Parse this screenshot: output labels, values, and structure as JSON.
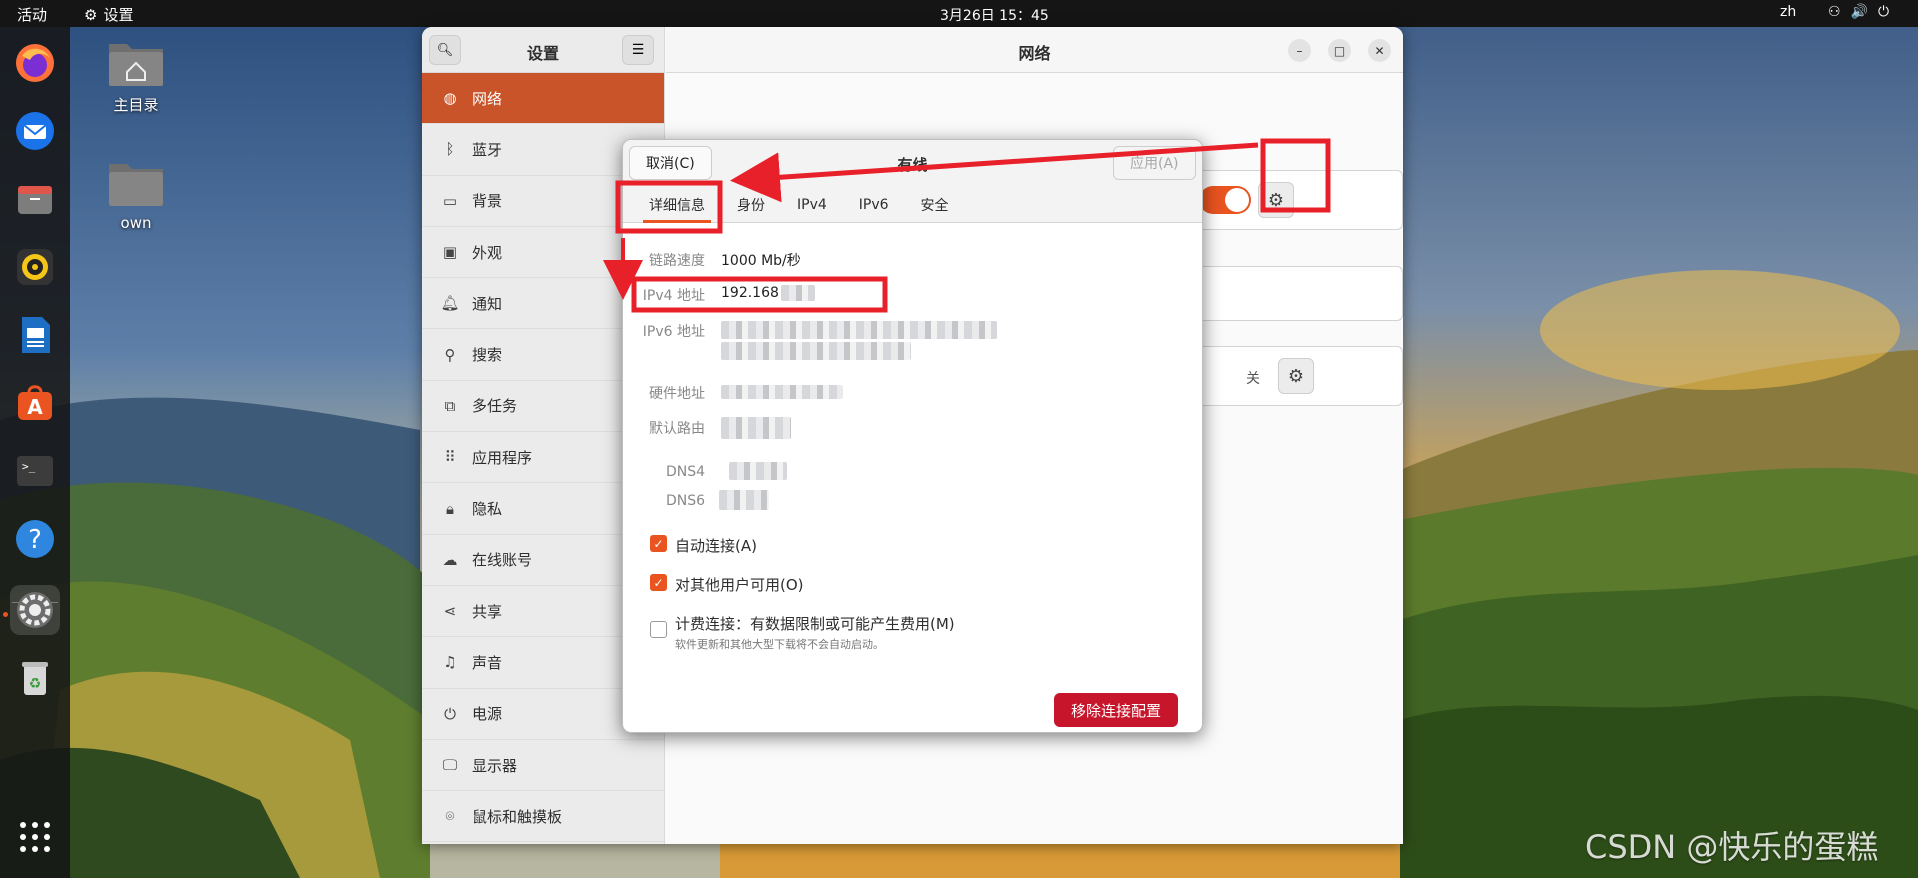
{
  "topbar": {
    "activities": "活动",
    "app_name": "设置",
    "clock": "3月26日  15：45",
    "lang": "zh"
  },
  "dock": {
    "items": [
      "firefox-icon",
      "thunderbird-icon",
      "files-icon",
      "rhythmbox-icon",
      "writer-icon",
      "app-center-icon",
      "terminal-icon",
      "help-icon",
      "settings-icon",
      "trash-icon",
      "app-grid-icon"
    ]
  },
  "desktop": {
    "icons": [
      {
        "label": "主目录",
        "icon": "home-folder-icon"
      },
      {
        "label": "own",
        "icon": "folder-icon"
      }
    ]
  },
  "settings": {
    "sidebar_title": "设置",
    "items": [
      {
        "label": "网络",
        "icon": "network-icon",
        "selected": true
      },
      {
        "label": "蓝牙",
        "icon": "bluetooth-icon"
      },
      {
        "label": "背景",
        "icon": "background-icon"
      },
      {
        "label": "外观",
        "icon": "appearance-icon"
      },
      {
        "label": "通知",
        "icon": "bell-icon"
      },
      {
        "label": "搜索",
        "icon": "search-icon"
      },
      {
        "label": "多任务",
        "icon": "multitask-icon"
      },
      {
        "label": "应用程序",
        "icon": "apps-icon"
      },
      {
        "label": "隐私",
        "icon": "lock-icon"
      },
      {
        "label": "在线账号",
        "icon": "cloud-icon"
      },
      {
        "label": "共享",
        "icon": "share-icon"
      },
      {
        "label": "声音",
        "icon": "music-icon"
      },
      {
        "label": "电源",
        "icon": "power-icon"
      },
      {
        "label": "显示器",
        "icon": "display-icon"
      },
      {
        "label": "鼠标和触摸板",
        "icon": "mouse-icon"
      }
    ],
    "main_title": "网络",
    "wired_title": "有线",
    "vpn_off": "关"
  },
  "dialog": {
    "cancel": "取消(C)",
    "title": "有线",
    "apply": "应用(A)",
    "tabs": [
      "详细信息",
      "身份",
      "IPv4",
      "IPv6",
      "安全"
    ],
    "details": {
      "link_speed_label": "链路速度",
      "link_speed": "1000 Mb/秒",
      "ipv4_label": "IPv4 地址",
      "ipv4": "192.168",
      "ipv6_label": "IPv6 地址",
      "hw_label": "硬件地址",
      "route_label": "默认路由",
      "dns4_label": "DNS4",
      "dns6_label": "DNS6"
    },
    "auto_connect": "自动连接(A)",
    "all_users": "对其他用户可用(O)",
    "metered": "计费连接：有数据限制或可能产生费用(M)",
    "metered_hint": "软件更新和其他大型下载将不会自动启动。",
    "remove": "移除连接配置"
  },
  "colors": {
    "accent": "#e95420",
    "sidebar_selected": "#c9542a",
    "danger": "#c7162b",
    "annotation": "#e8202a"
  },
  "watermark": "CSDN @快乐的蛋糕"
}
